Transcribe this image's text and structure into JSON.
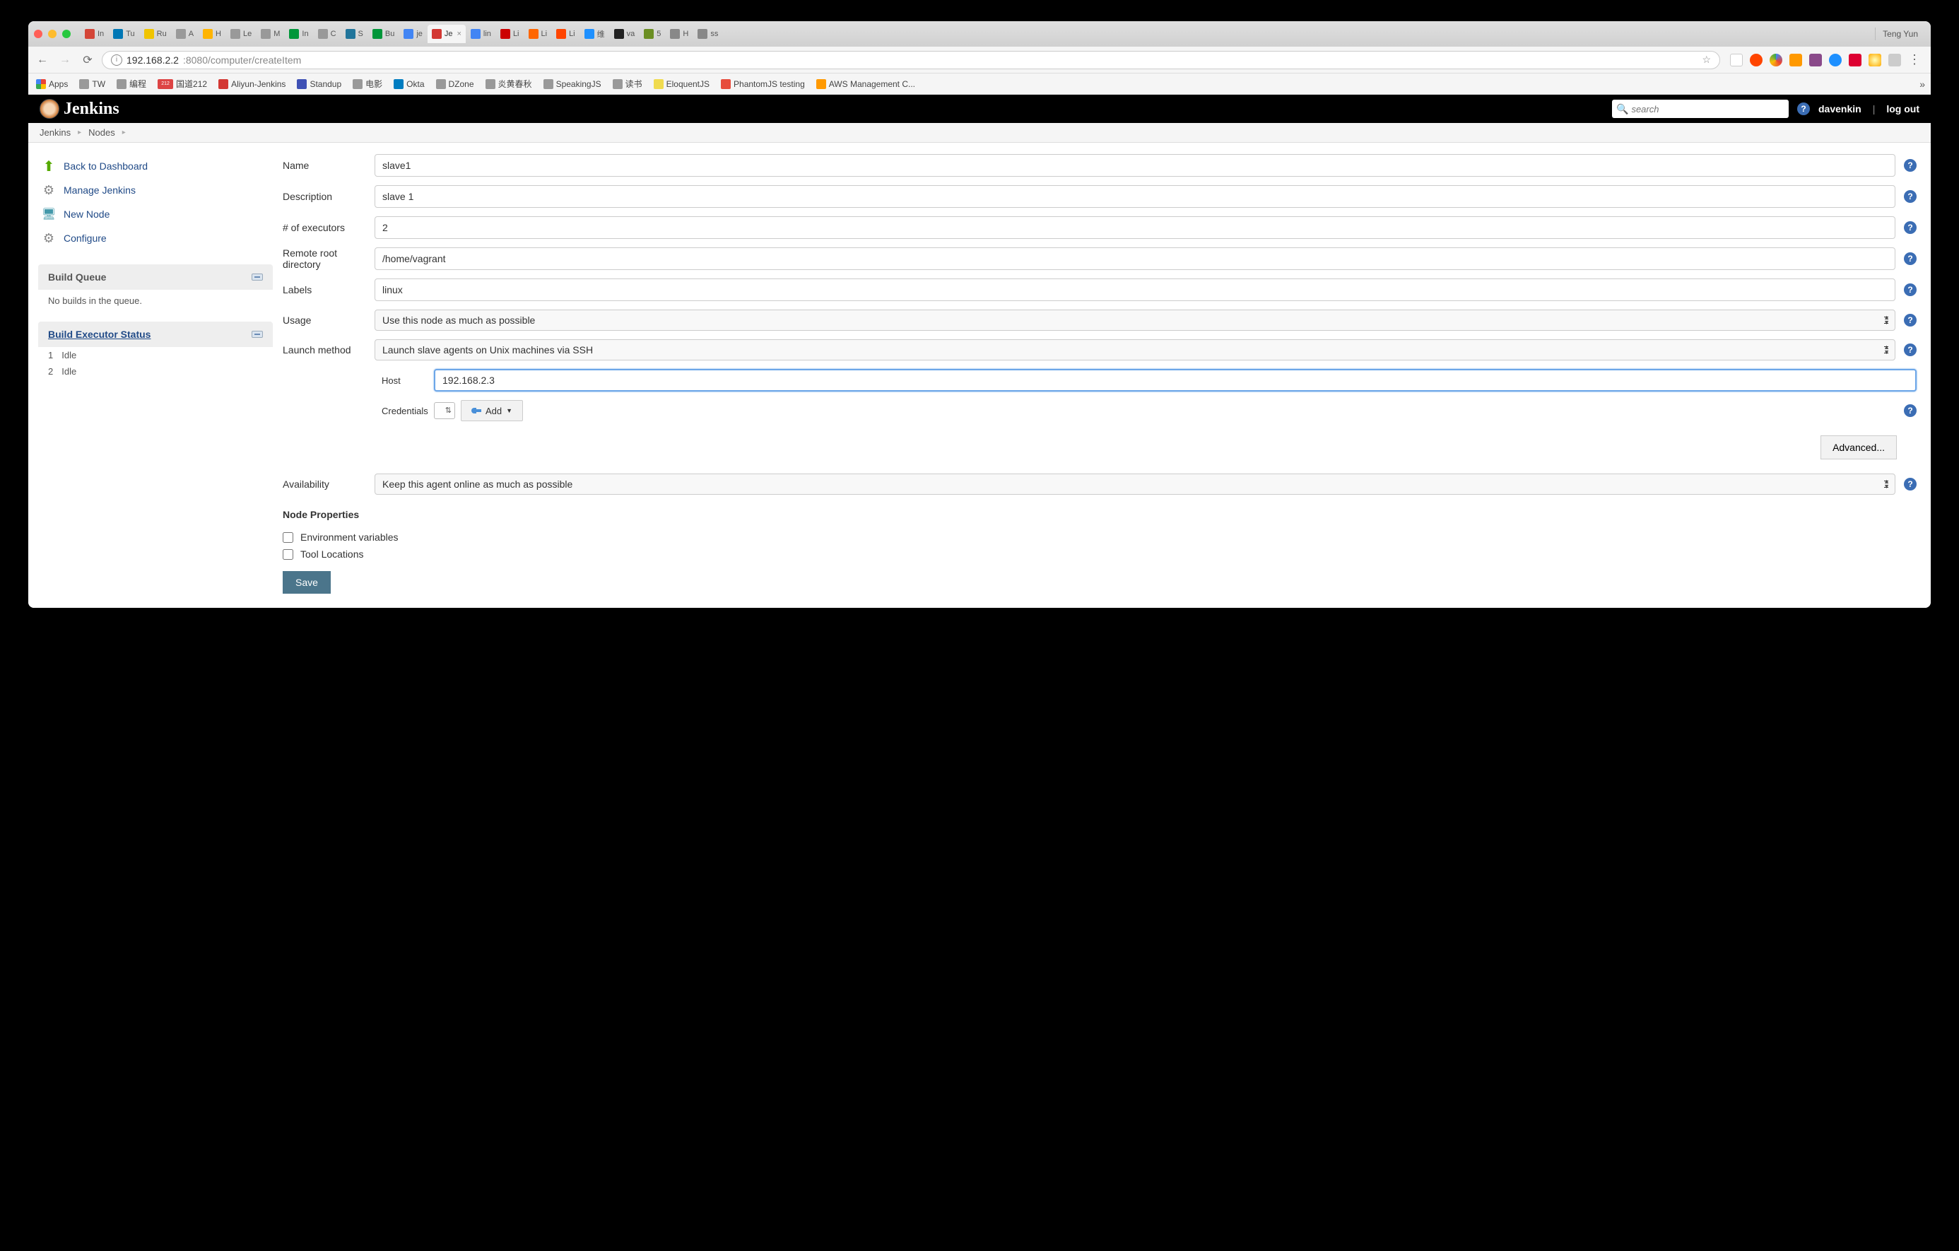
{
  "chrome": {
    "profile": "Teng Yun",
    "tabs": [
      {
        "label": "In",
        "favicon_bg": "#d44638"
      },
      {
        "label": "Tu",
        "favicon_bg": "#0077b5"
      },
      {
        "label": "Ru",
        "favicon_bg": "#f0c400"
      },
      {
        "label": "A",
        "favicon_bg": "#999"
      },
      {
        "label": "H",
        "favicon_bg": "#ffb400"
      },
      {
        "label": "Le",
        "favicon_bg": "#999"
      },
      {
        "label": "M",
        "favicon_bg": "#999"
      },
      {
        "label": "In",
        "favicon_bg": "#009639"
      },
      {
        "label": "C",
        "favicon_bg": "#999"
      },
      {
        "label": "S",
        "favicon_bg": "#21759b"
      },
      {
        "label": "Bu",
        "favicon_bg": "#009639"
      },
      {
        "label": "je",
        "favicon_bg": "#4285f4"
      },
      {
        "label": "Je",
        "favicon_bg": "#d33833",
        "active": true
      },
      {
        "label": "lin",
        "favicon_bg": "#4285f4"
      },
      {
        "label": "Li",
        "favicon_bg": "#cc0000"
      },
      {
        "label": "Li",
        "favicon_bg": "#ff6600"
      },
      {
        "label": "Li",
        "favicon_bg": "#ff4500"
      },
      {
        "label": "维",
        "favicon_bg": "#1e90ff"
      },
      {
        "label": "va",
        "favicon_bg": "#222"
      },
      {
        "label": "5",
        "favicon_bg": "#6b8e23"
      },
      {
        "label": "H",
        "favicon_bg": "#888"
      },
      {
        "label": "ss",
        "favicon_bg": "#888"
      }
    ],
    "url_host": "192.168.2.2",
    "url_rest": ":8080/computer/createItem",
    "bookmarks": [
      {
        "label": "Apps",
        "color": "#4285f4"
      },
      {
        "label": "TW",
        "color": "#999"
      },
      {
        "label": "编程",
        "color": "#999"
      },
      {
        "label": "国道212",
        "badge": "212",
        "color": "#d44"
      },
      {
        "label": "Aliyun-Jenkins",
        "color": "#d33833"
      },
      {
        "label": "Standup",
        "color": "#3f51b5"
      },
      {
        "label": "电影",
        "color": "#999"
      },
      {
        "label": "Okta",
        "color": "#007dc1"
      },
      {
        "label": "DZone",
        "color": "#999"
      },
      {
        "label": "炎黄春秋",
        "color": "#999"
      },
      {
        "label": "SpeakingJS",
        "color": "#999"
      },
      {
        "label": "读书",
        "color": "#999"
      },
      {
        "label": "EloquentJS",
        "color": "#f0db4f"
      },
      {
        "label": "PhantomJS testing",
        "color": "#e74c3c"
      },
      {
        "label": "AWS Management C...",
        "color": "#ff9900"
      }
    ]
  },
  "header": {
    "brand": "Jenkins",
    "search_placeholder": "search",
    "user": "davenkin",
    "logout": "log out"
  },
  "breadcrumb": [
    "Jenkins",
    "Nodes"
  ],
  "sidebar": {
    "links": [
      {
        "label": "Back to Dashboard",
        "icon": "arrow-up-icon"
      },
      {
        "label": "Manage Jenkins",
        "icon": "gear-icon"
      },
      {
        "label": "New Node",
        "icon": "computer-icon"
      },
      {
        "label": "Configure",
        "icon": "gear-icon"
      }
    ],
    "build_queue": {
      "title": "Build Queue",
      "empty": "No builds in the queue."
    },
    "executor": {
      "title": "Build Executor Status",
      "rows": [
        {
          "n": "1",
          "state": "Idle"
        },
        {
          "n": "2",
          "state": "Idle"
        }
      ]
    }
  },
  "form": {
    "name": {
      "label": "Name",
      "value": "slave1"
    },
    "description": {
      "label": "Description",
      "value": "slave 1"
    },
    "executors": {
      "label": "# of executors",
      "value": "2"
    },
    "remote_root": {
      "label": "Remote root directory",
      "value": "/home/vagrant"
    },
    "labels": {
      "label": "Labels",
      "value": "linux"
    },
    "usage": {
      "label": "Usage",
      "value": "Use this node as much as possible"
    },
    "launch": {
      "label": "Launch method",
      "value": "Launch slave agents on Unix machines via SSH"
    },
    "host": {
      "label": "Host",
      "value": "192.168.2.3"
    },
    "credentials": {
      "label": "Credentials",
      "add": "Add"
    },
    "advanced": "Advanced...",
    "availability": {
      "label": "Availability",
      "value": "Keep this agent online as much as possible"
    },
    "node_props": {
      "title": "Node Properties",
      "env": "Environment variables",
      "tools": "Tool Locations"
    },
    "save": "Save"
  }
}
